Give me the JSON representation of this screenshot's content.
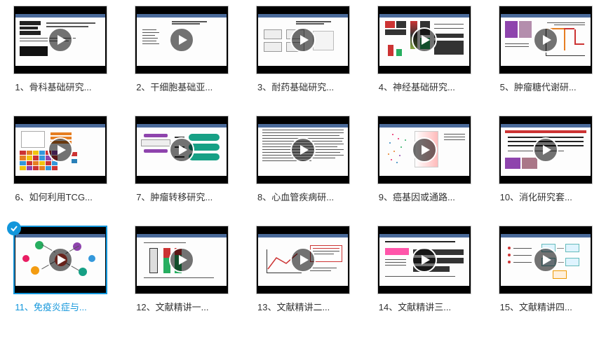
{
  "videos": [
    {
      "label": "1、骨科基础研究...",
      "selected": false
    },
    {
      "label": "2、干细胞基础亚...",
      "selected": false
    },
    {
      "label": "3、耐药基础研究...",
      "selected": false
    },
    {
      "label": "4、神经基础研究...",
      "selected": false
    },
    {
      "label": "5、肿瘤糖代谢研...",
      "selected": false
    },
    {
      "label": "6、如何利用TCG...",
      "selected": false
    },
    {
      "label": "7、肿瘤转移研究...",
      "selected": false
    },
    {
      "label": "8、心血管疾病研...",
      "selected": false
    },
    {
      "label": "9、癌基因或通路...",
      "selected": false
    },
    {
      "label": "10、消化研究套...",
      "selected": false
    },
    {
      "label": "11、免疫炎症与...",
      "selected": true
    },
    {
      "label": "12、文献精讲一...",
      "selected": false
    },
    {
      "label": "13、文献精讲二...",
      "selected": false
    },
    {
      "label": "14、文献精讲三...",
      "selected": false
    },
    {
      "label": "15、文献精讲四...",
      "selected": false
    }
  ],
  "icons": {
    "play": "play-icon",
    "check": "check-icon"
  }
}
